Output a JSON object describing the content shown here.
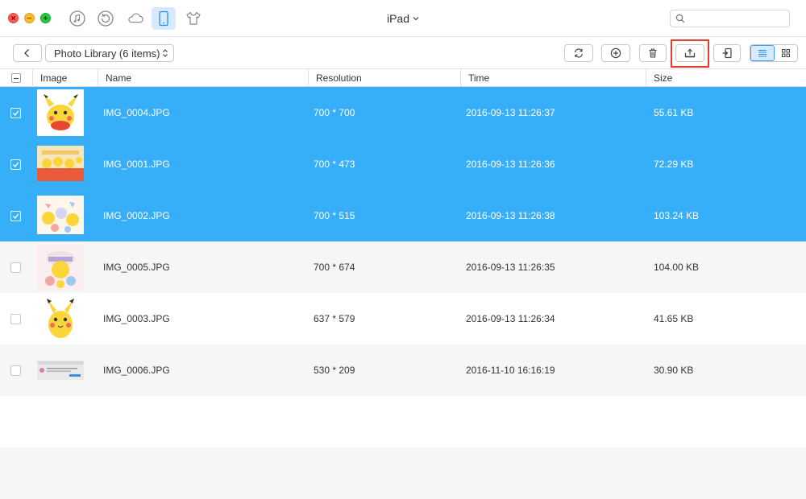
{
  "window": {
    "device_title": "iPad"
  },
  "search": {
    "placeholder": "",
    "value": ""
  },
  "toolbar": {
    "album_label": "Photo Library (6 items)"
  },
  "columns": {
    "image": "Image",
    "name": "Name",
    "resolution": "Resolution",
    "time": "Time",
    "size": "Size"
  },
  "colors": {
    "selection": "#36aef8",
    "accent": "#3aa0f0",
    "highlight": "#e8392c"
  },
  "icons": {
    "top_nav": [
      "music-icon",
      "backup-icon",
      "icloud-icon",
      "ipad-icon",
      "tshirt-icon"
    ],
    "toolbar": [
      "back-icon",
      "refresh-icon",
      "add-icon",
      "delete-icon",
      "export-icon",
      "send-to-device-icon",
      "list-view-icon",
      "grid-view-icon"
    ]
  },
  "rows": [
    {
      "name": "IMG_0004.JPG",
      "resolution": "700 * 700",
      "time": "2016-09-13 11:26:37",
      "size": "55.61 KB",
      "selected": true
    },
    {
      "name": "IMG_0001.JPG",
      "resolution": "700 * 473",
      "time": "2016-09-13 11:26:36",
      "size": "72.29 KB",
      "selected": true
    },
    {
      "name": "IMG_0002.JPG",
      "resolution": "700 * 515",
      "time": "2016-09-13 11:26:38",
      "size": "103.24 KB",
      "selected": true
    },
    {
      "name": "IMG_0005.JPG",
      "resolution": "700 * 674",
      "time": "2016-09-13 11:26:35",
      "size": "104.00 KB",
      "selected": false
    },
    {
      "name": "IMG_0003.JPG",
      "resolution": "637 * 579",
      "time": "2016-09-13 11:26:34",
      "size": "41.65 KB",
      "selected": false
    },
    {
      "name": "IMG_0006.JPG",
      "resolution": "530 * 209",
      "time": "2016-11-10 16:16:19",
      "size": "30.90 KB",
      "selected": false
    }
  ]
}
